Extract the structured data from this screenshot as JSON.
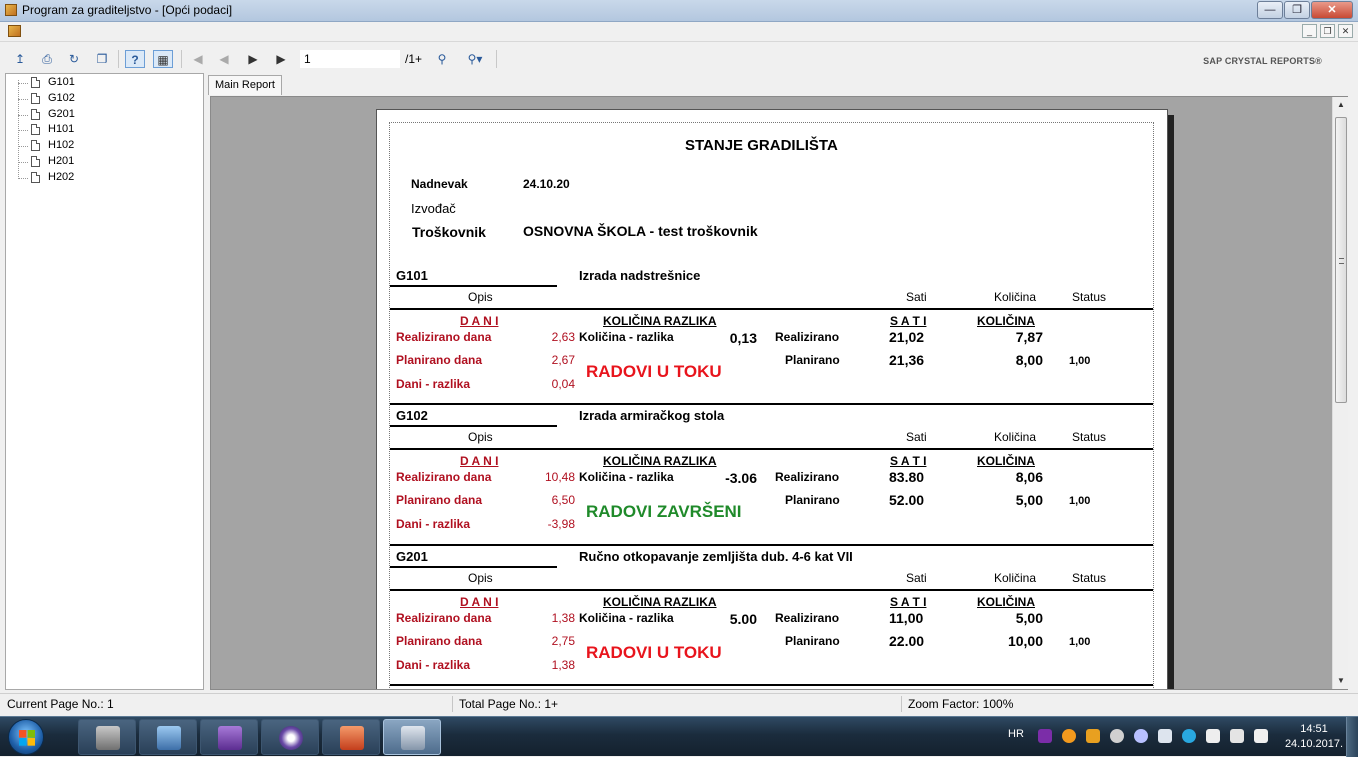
{
  "window": {
    "title": "Program za graditeljstvo - [Opći podaci]"
  },
  "toolbar": {
    "page_value": "1",
    "page_count": "/1+",
    "brand": "SAP CRYSTAL REPORTS®",
    "buttons": [
      "export-icon",
      "print-icon",
      "refresh-icon",
      "copy-icon",
      "help-icon",
      "group-tree-icon",
      "first-page-icon",
      "prev-page-icon",
      "next-page-icon",
      "last-page-icon",
      "find-icon",
      "zoom-icon"
    ]
  },
  "tree": {
    "items": [
      "G101",
      "G102",
      "G201",
      "H101",
      "H102",
      "H201",
      "H202"
    ]
  },
  "tabs": {
    "main": "Main Report"
  },
  "report": {
    "title": "STANJE GRADILIŠTA",
    "nadnevak_label": "Nadnevak",
    "nadnevak_value": "24.10.20",
    "izvodjac_label": "Izvođač",
    "troskovnik_label": "Troškovnik",
    "troskovnik_value": "OSNOVNA ŠKOLA - test troškovnik",
    "col_opis": "Opis",
    "col_sati": "Sati",
    "col_kolicina": "Količina",
    "col_status": "Status",
    "dani_header": "D A N I",
    "kolicina_razlika_header": "KOLIČINA RAZLIKA",
    "sati_header": "S A T I",
    "kolicina_header": "KOLIČINA",
    "realizirano_dana_label": "Realizirano dana",
    "planirano_dana_label": "Planirano dana",
    "dani_razlika_label": "Dani - razlika",
    "kolicina_razlika_label": "Količina - razlika",
    "realizirano_label": "Realizirano",
    "planirano_label": "Planirano",
    "groups": [
      {
        "code": "G101",
        "desc": "Izrada nadstrešnice",
        "realizirano_dana": "2,63",
        "planirano_dana": "2,67",
        "dani_razlika": "0,04",
        "kolicina_razlika": "0,13",
        "sati_realizirano": "21,02",
        "sati_planirano": "21,36",
        "kolicina_realizirano": "7,87",
        "kolicina_planirano": "8,00",
        "status": "1,00",
        "state": "RADOVI U TOKU",
        "state_color": "#e8141c"
      },
      {
        "code": "G102",
        "desc": "Izrada armiračkog stola",
        "realizirano_dana": "10,48",
        "planirano_dana": "6,50",
        "dani_razlika": "-3,98",
        "kolicina_razlika": "-3.06",
        "sati_realizirano": "83.80",
        "sati_planirano": "52.00",
        "kolicina_realizirano": "8,06",
        "kolicina_planirano": "5,00",
        "status": "1,00",
        "state": "RADOVI ZAVRŠENI",
        "state_color": "#1f8a2a"
      },
      {
        "code": "G201",
        "desc": "Ručno otkopavanje zemljišta dub. 4-6 kat VII",
        "realizirano_dana": "1,38",
        "planirano_dana": "2,75",
        "dani_razlika": "1,38",
        "kolicina_razlika": "5.00",
        "sati_realizirano": "11,00",
        "sati_planirano": "22.00",
        "kolicina_realizirano": "5,00",
        "kolicina_planirano": "10,00",
        "status": "1,00",
        "state": "RADOVI U TOKU",
        "state_color": "#e8141c"
      }
    ]
  },
  "status": {
    "current_page": "Current Page No.: 1",
    "total_page": "Total Page No.: 1+",
    "zoom": "Zoom Factor: 100%"
  },
  "taskbar": {
    "lang": "HR",
    "time": "14:51",
    "date": "24.10.2017."
  }
}
